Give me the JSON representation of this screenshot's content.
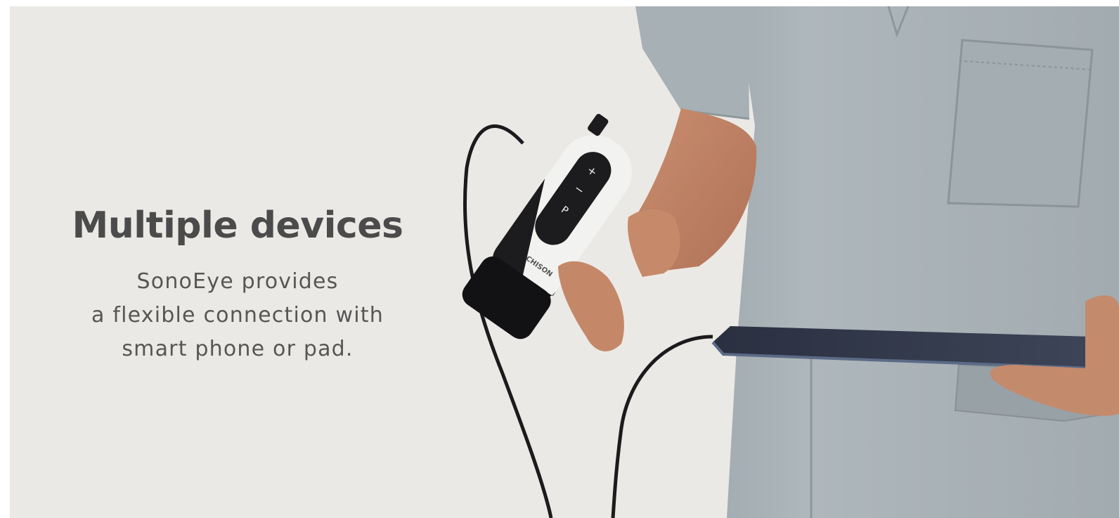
{
  "banner": {
    "headline": "Multiple devices",
    "copy_lines": [
      "SonoEye provides",
      "a flexible connection with",
      "smart phone or pad."
    ],
    "probe_brand": "CHISON",
    "probe_buttons": [
      "+",
      "−",
      "P"
    ]
  },
  "colors": {
    "background": "#ebe9e5",
    "scrubs": "#a9b2b6",
    "text": "#4b4b4b",
    "probe_white": "#f2f2f0",
    "probe_black": "#1c1c1e"
  }
}
